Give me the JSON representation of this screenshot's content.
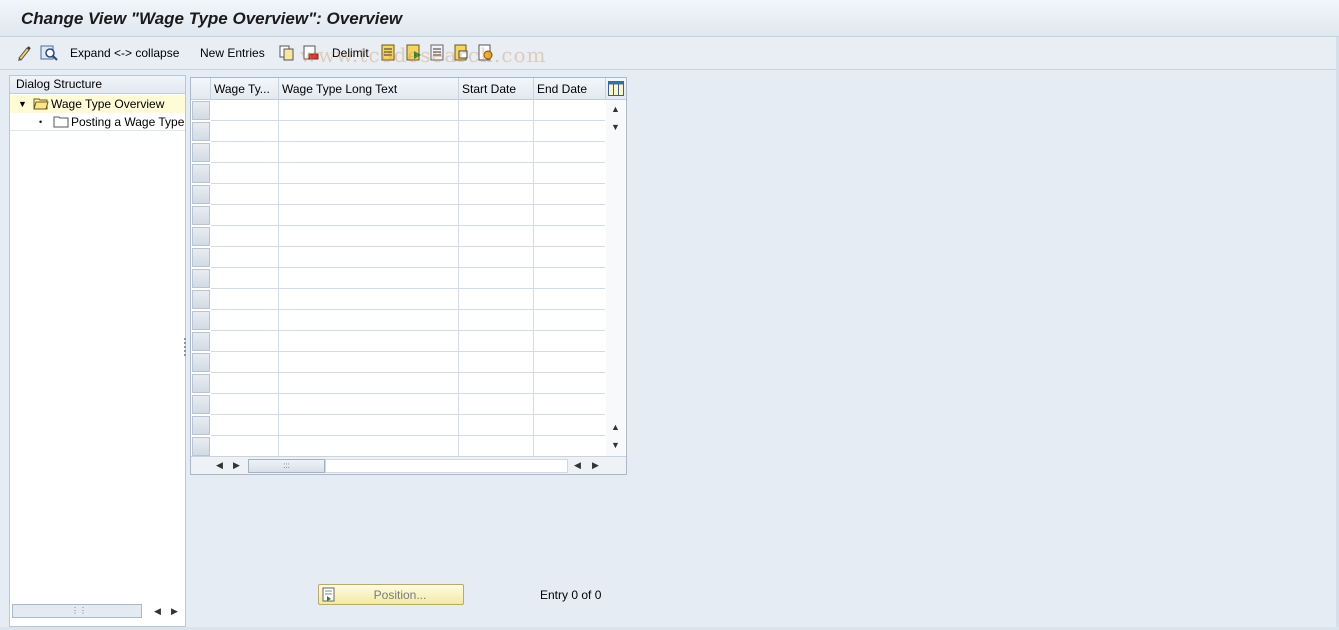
{
  "title": "Change View \"Wage Type Overview\": Overview",
  "toolbar": {
    "expand_collapse": "Expand <-> collapse",
    "new_entries": "New Entries",
    "delimit": "Delimit",
    "icons": [
      "display-change-icon",
      "find-icon",
      "copy-as-icon",
      "delete-icon",
      "select-all-icon",
      "select-block-icon",
      "deselect-all-icon",
      "print-icon",
      "config-icon"
    ]
  },
  "dialog_structure": {
    "header": "Dialog Structure",
    "items": [
      {
        "label": "Wage Type Overview",
        "selected": true,
        "expanded": true
      },
      {
        "label": "Posting a Wage Type",
        "selected": false
      }
    ]
  },
  "table": {
    "columns": [
      "Wage Ty...",
      "Wage Type Long Text",
      "Start Date",
      "End Date"
    ],
    "rows": []
  },
  "footer": {
    "position_button": "Position...",
    "entry_text": "Entry 0 of 0"
  },
  "watermark": "www.tcodesearch.com",
  "colors": {
    "selected_row": "#fffbd7",
    "position_button": "#f3e9a8",
    "background": "#e6ecf4"
  }
}
